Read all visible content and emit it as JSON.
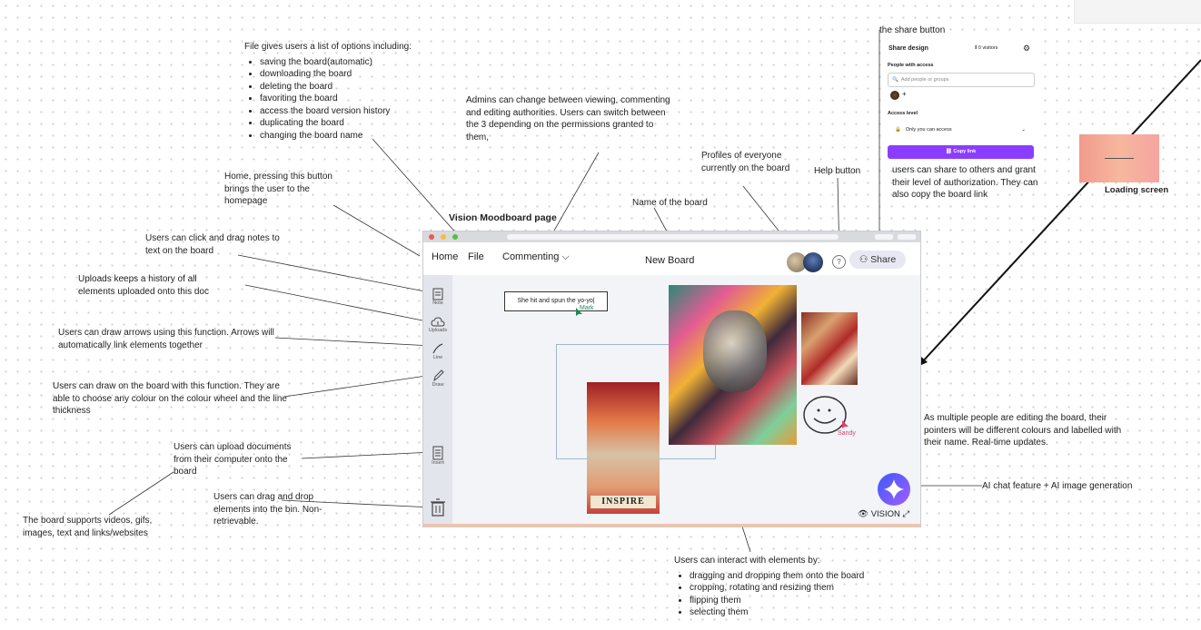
{
  "page_title": "Vision Moodboard page",
  "loading_title": "Loading screen",
  "board": {
    "nav": {
      "home": "Home",
      "file": "File",
      "commenting": "Commenting"
    },
    "name": "New Board",
    "help": "?",
    "share": "Share",
    "tools": [
      {
        "label": "Note"
      },
      {
        "label": "Uploads"
      },
      {
        "label": "Line"
      },
      {
        "label": "Draw"
      },
      {
        "label": "Insert"
      }
    ],
    "note_text": "She hit and spun the yo-yo|",
    "cursor_mark": "Mark",
    "cursor_sandy": "Sandy",
    "collage_text": "INSPIRE",
    "brand": "VISION"
  },
  "share_panel": {
    "title": "Share design",
    "visitors": "0 visitors",
    "people_label": "People with access",
    "search_placeholder": "Add people or groups",
    "access_label": "Access level",
    "access_value": "Only you can access",
    "copy_link": "Copy link"
  },
  "annotations": {
    "file_intro": "File gives users a list of options including:",
    "file_options": [
      "saving the board(automatic)",
      "downloading the board",
      "deleting the board",
      "favoriting the board",
      "access the board version history",
      "duplicating the board",
      "changing the board name"
    ],
    "admins": "Admins can change between viewing, commenting and editing authorities. Users can switch between the 3 depending on the permissions granted to them,",
    "profiles": "Profiles of everyone currently on the board",
    "help": "Help button",
    "share_button": "the share button",
    "share_desc": "users can share to others and grant their level of authorization. They can also copy the board link",
    "home": "Home, pressing this button brings the user to the homepage",
    "name": "Name of the board",
    "notes": "Users can click and drag notes to text on the board",
    "uploads": "Uploads keeps a history of all elements uploaded onto this doc",
    "arrows": "Users can draw arrows using this function. Arrows will automatically link elements together",
    "draw": "Users can draw on the board with this function. They are able to choose any colour on the colour wheel and the line thickness",
    "insert": "Users can upload documents from their computer onto the board",
    "bin": "Users can drag and drop elements into the bin. Non-retrievable.",
    "supports": "The board supports videos, gifs, images, text and links/websites",
    "multiple": "As multiple people are editing the board, their pointers will be different colours and labelled with their name. Real-time updates.",
    "ai": "AI chat feature + AI image generation",
    "interact_intro": "Users can interact with elements by:",
    "interact_options": [
      "dragging and dropping them onto the board",
      "cropping, rotating and resizing them",
      "flipping them",
      "selecting them"
    ]
  }
}
